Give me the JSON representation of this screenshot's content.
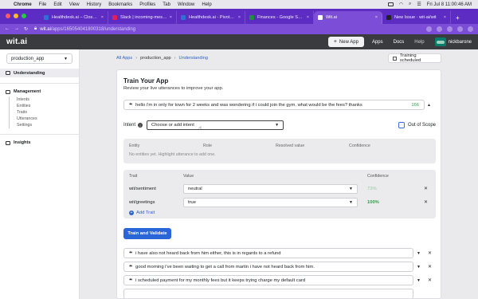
{
  "menubar": {
    "app": "Chrome",
    "items": [
      "File",
      "Edit",
      "View",
      "History",
      "Bookmarks",
      "Profiles",
      "Tab",
      "Window",
      "Help"
    ],
    "clock": "Fri Jul 8  11:00:46 AM"
  },
  "tabs": [
    {
      "title": "Healthdesk.ai – Closed (",
      "favicon_color": "#2f6fd6",
      "active": false
    },
    {
      "title": "Slack | incoming-messag",
      "favicon_color": "#e01e5a",
      "active": false
    },
    {
      "title": "Healthdesk.ai - Pivotal T",
      "favicon_color": "#2f6fd6",
      "active": false
    },
    {
      "title": "Finances - Google Shee",
      "favicon_color": "#1e8e3e",
      "active": false
    },
    {
      "title": "Wit.ai",
      "favicon_color": "#ffffff",
      "active": true
    },
    {
      "title": "New Issue · wit-ai/wit",
      "favicon_color": "#222222",
      "active": false
    }
  ],
  "address": {
    "host": "wit.ai",
    "path": "/apps/1650540418003​18/understanding"
  },
  "header": {
    "logo": "wit.ai",
    "new_app": "New App",
    "links": [
      "Apps",
      "Docs",
      "Help"
    ],
    "username": "nickbarone"
  },
  "sidebar": {
    "app_select": "production_app",
    "understanding": "Understanding",
    "management": "Management",
    "management_items": [
      "Intents",
      "Entities",
      "Traits",
      "Utterances",
      "Settings"
    ],
    "insights": "Insights"
  },
  "breadcrumb": [
    "All Apps",
    "production_app",
    "Understanding"
  ],
  "training_status": "Training scheduled",
  "train": {
    "title": "Train Your App",
    "subtitle": "Review your live utterances to improve your app.",
    "utterance": "hello  i'm in only for town for 2 weeks and was wondering if i could join the gym. what would be the fees?  thanks",
    "utterance_count": "166",
    "intent_label": "Intent",
    "intent_placeholder": "Choose or add intent",
    "out_of_scope": "Out of Scope",
    "entity_headers": [
      "Entity",
      "Role",
      "Resolved value",
      "Confidence"
    ],
    "entity_empty": "No entities yet. Highlight utterance to add one.",
    "trait_headers": [
      "Trait",
      "Value",
      "Confidence"
    ],
    "traits": [
      {
        "name": "wit/sentiment",
        "value": "neutral",
        "confidence": "73%"
      },
      {
        "name": "wit/greetings",
        "value": "true",
        "confidence": "100%"
      }
    ],
    "add_trait": "Add Trait",
    "train_button": "Train and Validate"
  },
  "utterances": [
    "i have also not heard  back from him either, this is in regards  to a refund",
    "good morning  i've  been waiting  to get a call from martin i have not heard back from him.",
    "i scheduled payment for my monthly fees but it keeps trying charge my default card"
  ]
}
